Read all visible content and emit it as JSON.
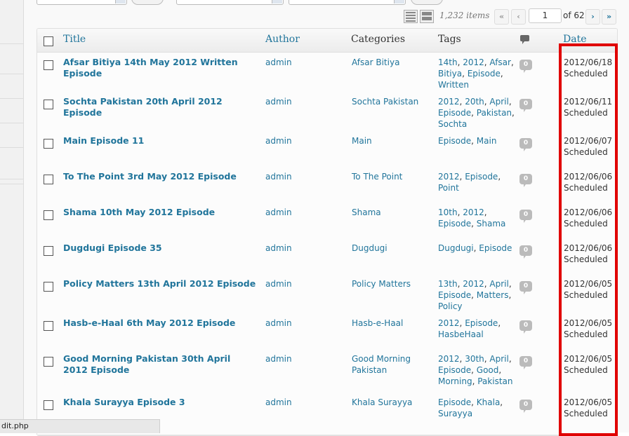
{
  "status_bar": {
    "text": "dit.php"
  },
  "pagination": {
    "items_count": "1,232 items",
    "first": "«",
    "prev": "‹",
    "current_page": "1",
    "of_pages": "of 62",
    "next": "›",
    "last": "»"
  },
  "table": {
    "headers": {
      "title": "Title",
      "author": "Author",
      "categories": "Categories",
      "tags": "Tags",
      "date": "Date"
    },
    "rows": [
      {
        "title": "Afsar Bitiya 14th May 2012 Written Episode",
        "author": "admin",
        "categories": "Afsar Bitiya",
        "tags": [
          "14th",
          "2012",
          "Afsar",
          "Bitiya",
          "Episode",
          "Written"
        ],
        "comments": "0",
        "date": "2012/06/18",
        "status": "Scheduled"
      },
      {
        "title": "Sochta Pakistan 20th April 2012 Episode",
        "author": "admin",
        "categories": "Sochta Pakistan",
        "tags": [
          "2012",
          "20th",
          "April",
          "Episode",
          "Pakistan",
          "Sochta"
        ],
        "comments": "0",
        "date": "2012/06/11",
        "status": "Scheduled"
      },
      {
        "title": "Main Episode 11",
        "author": "admin",
        "categories": "Main",
        "tags": [
          "Episode",
          "Main"
        ],
        "comments": "0",
        "date": "2012/06/07",
        "status": "Scheduled"
      },
      {
        "title": "To The Point 3rd May 2012 Episode",
        "author": "admin",
        "categories": "To The Point",
        "tags": [
          "2012",
          "Episode",
          "Point"
        ],
        "comments": "0",
        "date": "2012/06/06",
        "status": "Scheduled"
      },
      {
        "title": "Shama 10th May 2012 Episode",
        "author": "admin",
        "categories": "Shama",
        "tags": [
          "10th",
          "2012",
          "Episode",
          "Shama"
        ],
        "comments": "0",
        "date": "2012/06/06",
        "status": "Scheduled"
      },
      {
        "title": "Dugdugi Episode 35",
        "author": "admin",
        "categories": "Dugdugi",
        "tags": [
          "Dugdugi",
          "Episode"
        ],
        "comments": "0",
        "date": "2012/06/06",
        "status": "Scheduled"
      },
      {
        "title": "Policy Matters 13th April 2012 Episode",
        "author": "admin",
        "categories": "Policy Matters",
        "tags": [
          "13th",
          "2012",
          "April",
          "Episode",
          "Matters",
          "Policy"
        ],
        "comments": "0",
        "date": "2012/06/05",
        "status": "Scheduled"
      },
      {
        "title": "Hasb-e-Haal 6th May 2012 Episode",
        "author": "admin",
        "categories": "Hasb-e-Haal",
        "tags": [
          "2012",
          "Episode",
          "HasbeHaal"
        ],
        "comments": "0",
        "date": "2012/06/05",
        "status": "Scheduled"
      },
      {
        "title": "Good Morning Pakistan 30th April 2012 Episode",
        "author": "admin",
        "categories": "Good Morning Pakistan",
        "tags": [
          "2012",
          "30th",
          "April",
          "Episode",
          "Good",
          "Morning",
          "Pakistan"
        ],
        "comments": "0",
        "date": "2012/06/05",
        "status": "Scheduled"
      },
      {
        "title": "Khala Surayya Episode 3",
        "author": "admin",
        "categories": "Khala Surayya",
        "tags": [
          "Episode",
          "Khala",
          "Surayya"
        ],
        "comments": "0",
        "date": "2012/06/05",
        "status": "Scheduled"
      }
    ]
  },
  "colors": {
    "link": "#21759b",
    "highlight": "#e00000",
    "comment_bubble": "#bbbbbb"
  },
  "icons": {
    "list_view": "list-view-icon",
    "excerpt_view": "excerpt-view-icon",
    "comments_header": "comment-icon"
  }
}
